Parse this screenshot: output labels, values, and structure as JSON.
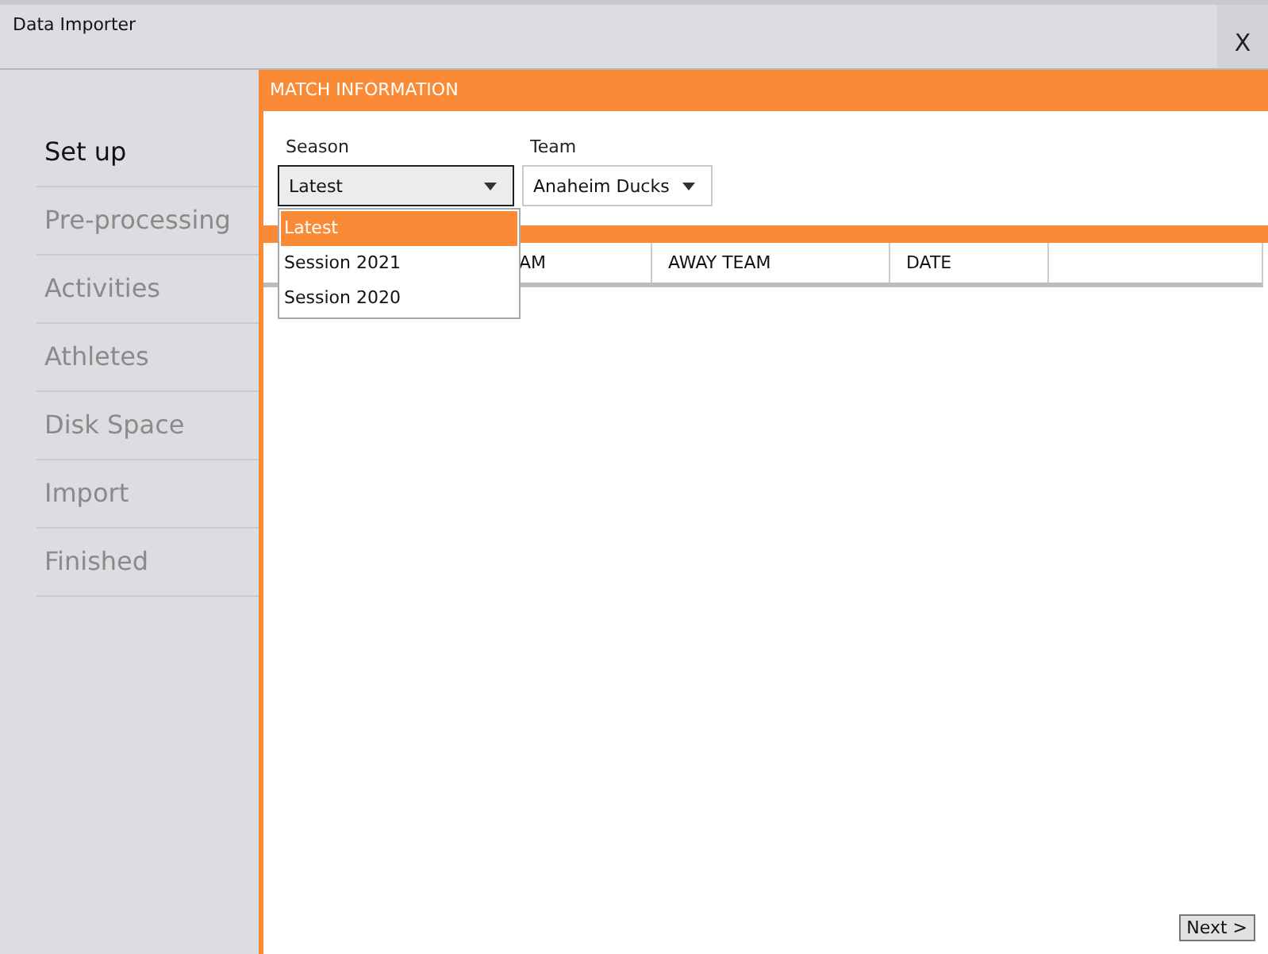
{
  "window": {
    "title": "Data Importer",
    "close": "X"
  },
  "steps": [
    {
      "label": "Set up",
      "selected": true
    },
    {
      "label": "Pre-processing",
      "selected": false
    },
    {
      "label": "Activities",
      "selected": false
    },
    {
      "label": "Athletes",
      "selected": false
    },
    {
      "label": "Disk Space",
      "selected": false
    },
    {
      "label": "Import",
      "selected": false
    },
    {
      "label": "Finished",
      "selected": false
    }
  ],
  "panel": {
    "title": "MATCH INFORMATION"
  },
  "season": {
    "label": "Season",
    "value": "Latest",
    "expanded": true,
    "options": [
      {
        "label": "Latest",
        "selected": true
      },
      {
        "label": "Session 2021",
        "selected": false
      },
      {
        "label": "Session 2020",
        "selected": false
      }
    ]
  },
  "team": {
    "label": "Team",
    "value": "Anaheim Ducks"
  },
  "table": {
    "columns": [
      "AM",
      "AWAY TEAM",
      "DATE"
    ]
  },
  "next_button": "Next >"
}
